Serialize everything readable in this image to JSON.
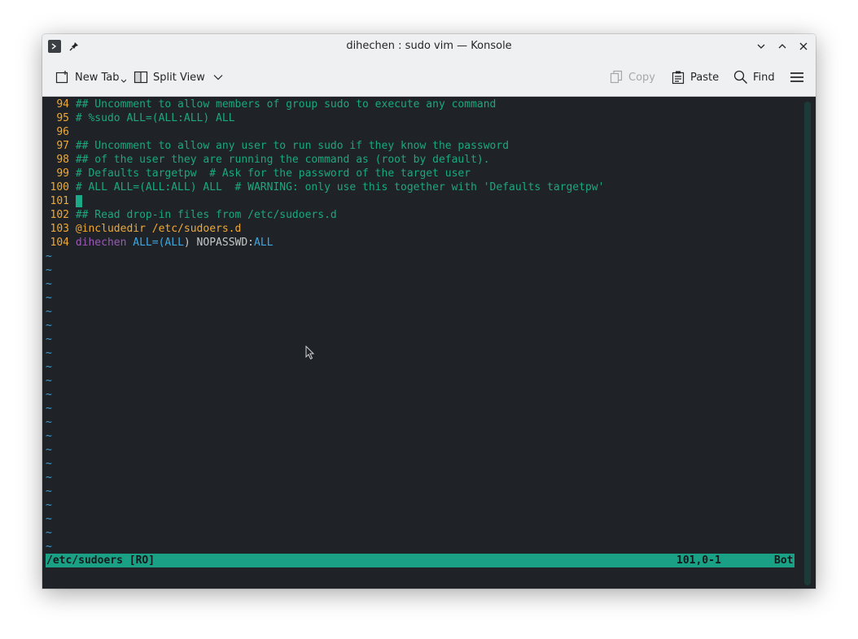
{
  "window": {
    "title": "dihechen : sudo vim — Konsole"
  },
  "toolbar": {
    "new_tab": "New Tab",
    "split_view": "Split View",
    "copy": "Copy",
    "paste": "Paste",
    "find": "Find"
  },
  "editor": {
    "lines": [
      {
        "num": "94",
        "text": "## Uncomment to allow members of group sudo to execute any command"
      },
      {
        "num": "95",
        "text": "# %sudo ALL=(ALL:ALL) ALL"
      },
      {
        "num": "96",
        "text": ""
      },
      {
        "num": "97",
        "text": "## Uncomment to allow any user to run sudo if they know the password"
      },
      {
        "num": "98",
        "text": "## of the user they are running the command as (root by default)."
      },
      {
        "num": "99",
        "text": "# Defaults targetpw  # Ask for the password of the target user"
      },
      {
        "num": "100",
        "text": "# ALL ALL=(ALL:ALL) ALL  # WARNING: only use this together with 'Defaults targetpw'"
      },
      {
        "num": "101",
        "text": ""
      },
      {
        "num": "102",
        "text": "## Read drop-in files from /etc/sudoers.d"
      },
      {
        "num": "103",
        "text": "@includedir /etc/sudoers.d"
      },
      {
        "num": "104",
        "user": "dihechen",
        "all1": "ALL",
        "eq": "=(",
        "all2": "ALL",
        "close": ") NOPASSWD:",
        "all3": "ALL"
      }
    ],
    "tilde": "~",
    "tilde_count": 22
  },
  "status": {
    "file": "/etc/sudoers [RO]",
    "position": "101,0-1",
    "scroll": "Bot"
  },
  "colors": {
    "background": "#1f2328",
    "line_number": "#f0a835",
    "comment": "#1aa87e",
    "status_bar": "#1aa085"
  }
}
